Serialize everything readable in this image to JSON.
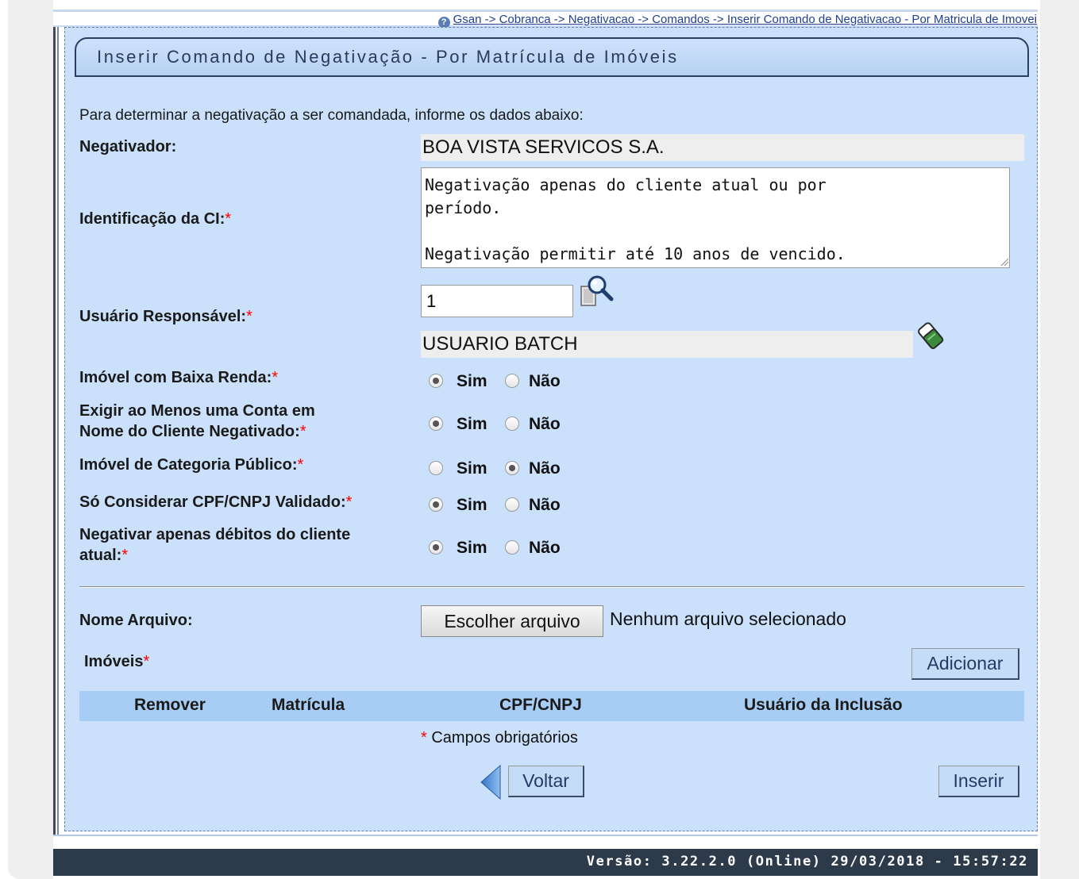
{
  "breadcrumb": {
    "icon": "help-icon",
    "path": "Gsan -> Cobranca -> Negativacao -> Comandos -> Inserir Comando de Negativacao - Por Matricula de Imovei"
  },
  "page_title": "Inserir Comando de Negativação - Por Matrícula de Imóveis",
  "intro": "Para determinar a negativação a ser comandada, informe os dados abaixo:",
  "fields": {
    "negativador": {
      "label": "Negativador:",
      "value": "BOA VISTA SERVICOS S.A."
    },
    "identificacao": {
      "label": "Identificação da CI:",
      "value": "Negativação apenas do cliente atual ou por\nperíodo.\n\nNegativação permitir até 10 anos de vencido."
    },
    "usuario": {
      "label": "Usuário Responsável:",
      "code": "1",
      "name": "USUARIO BATCH",
      "search_icon": "search-icon",
      "clear_icon": "eraser-icon"
    }
  },
  "required_mark": "*",
  "radios": {
    "yes_label": "Sim",
    "no_label": "Não",
    "baixa_renda": {
      "label": "Imóvel com Baixa Renda:",
      "selected": "Sim"
    },
    "conta_nome": {
      "label_line1": "Exigir ao Menos uma Conta em",
      "label_line2": "Nome do Cliente Negativado:",
      "selected": "Sim"
    },
    "categoria_publico": {
      "label": "Imóvel de Categoria Público:",
      "selected": "Não"
    },
    "cpf_validado": {
      "label": "Só Considerar CPF/CNPJ Validado:",
      "selected": "Sim"
    },
    "debitos_cliente": {
      "label_line1": "Negativar apenas débitos do cliente",
      "label_line2": "atual:",
      "selected": "Sim"
    }
  },
  "file": {
    "label": "Nome Arquivo:",
    "button": "Escolher arquivo",
    "status": "Nenhum arquivo selecionado"
  },
  "imoveis": {
    "label": "Imóveis",
    "add_button": "Adicionar",
    "columns": [
      "Remover",
      "Matrícula",
      "CPF/CNPJ",
      "Usuário da Inclusão"
    ]
  },
  "footnote": "Campos obrigatórios",
  "buttons": {
    "back": "Voltar",
    "insert": "Inserir"
  },
  "footer": {
    "version": "Versão: 3.22.2.0 (Online) 29/03/2018 - 15:57:22"
  }
}
